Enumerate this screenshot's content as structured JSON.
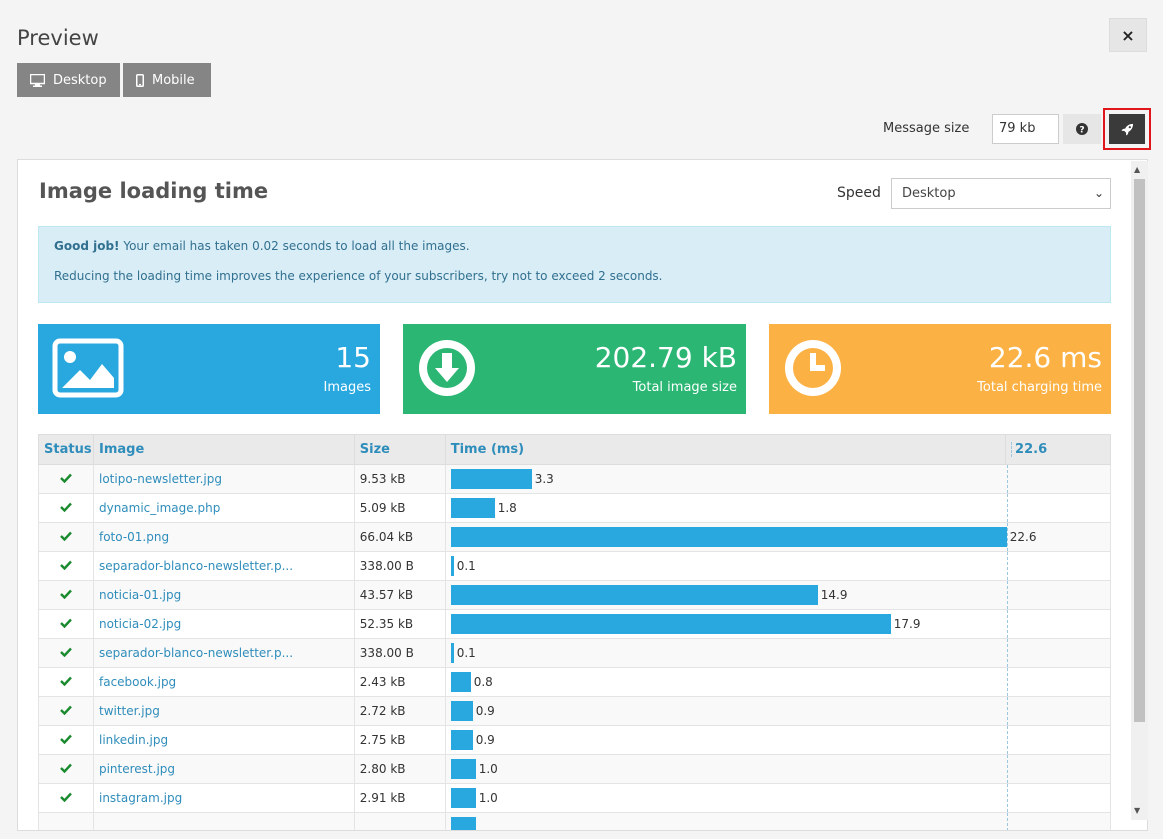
{
  "header": {
    "title": "Preview",
    "close_icon": "×"
  },
  "view_buttons": {
    "desktop_label": "Desktop",
    "mobile_label": "Mobile"
  },
  "message_size": {
    "label": "Message size",
    "value": "79 kb"
  },
  "panel": {
    "title": "Image loading time",
    "speed_label": "Speed",
    "speed_selected": "Desktop",
    "alert": {
      "strong": "Good job!",
      "line1": " Your email has taken 0.02 seconds to load all the images.",
      "line2": "Reducing the loading time improves the experience of your subscribers, try not to exceed 2 seconds."
    },
    "stats": [
      {
        "value": "15",
        "label": "Images",
        "color": "#29a8e0",
        "icon": "image-icon"
      },
      {
        "value": "202.79 kB",
        "label": "Total image size",
        "color": "#2bb673",
        "icon": "download-icon"
      },
      {
        "value": "22.6 ms",
        "label": "Total charging time",
        "color": "#fbb143",
        "icon": "clock-icon"
      }
    ],
    "table": {
      "headers": {
        "status": "Status",
        "image": "Image",
        "size": "Size",
        "time": "Time (ms)",
        "max": "22.6"
      },
      "max_time": 22.6,
      "rows": [
        {
          "image": "lotipo-newsletter.jpg",
          "size": "9.53 kB",
          "time": 3.3,
          "time_label": "3.3"
        },
        {
          "image": "dynamic_image.php",
          "size": "5.09 kB",
          "time": 1.8,
          "time_label": "1.8"
        },
        {
          "image": "foto-01.png",
          "size": "66.04 kB",
          "time": 22.6,
          "time_label": "22.6"
        },
        {
          "image": "separador-blanco-newsletter.p...",
          "size": "338.00 B",
          "time": 0.1,
          "time_label": "0.1"
        },
        {
          "image": "noticia-01.jpg",
          "size": "43.57 kB",
          "time": 14.9,
          "time_label": "14.9"
        },
        {
          "image": "noticia-02.jpg",
          "size": "52.35 kB",
          "time": 17.9,
          "time_label": "17.9"
        },
        {
          "image": "separador-blanco-newsletter.p...",
          "size": "338.00 B",
          "time": 0.1,
          "time_label": "0.1"
        },
        {
          "image": "facebook.jpg",
          "size": "2.43 kB",
          "time": 0.8,
          "time_label": "0.8"
        },
        {
          "image": "twitter.jpg",
          "size": "2.72 kB",
          "time": 0.9,
          "time_label": "0.9"
        },
        {
          "image": "linkedin.jpg",
          "size": "2.75 kB",
          "time": 0.9,
          "time_label": "0.9"
        },
        {
          "image": "pinterest.jpg",
          "size": "2.80 kB",
          "time": 1.0,
          "time_label": "1.0"
        },
        {
          "image": "instagram.jpg",
          "size": "2.91 kB",
          "time": 1.0,
          "time_label": "1.0"
        },
        {
          "image": "",
          "size": "",
          "time": 1.0,
          "time_label": ""
        }
      ]
    }
  }
}
